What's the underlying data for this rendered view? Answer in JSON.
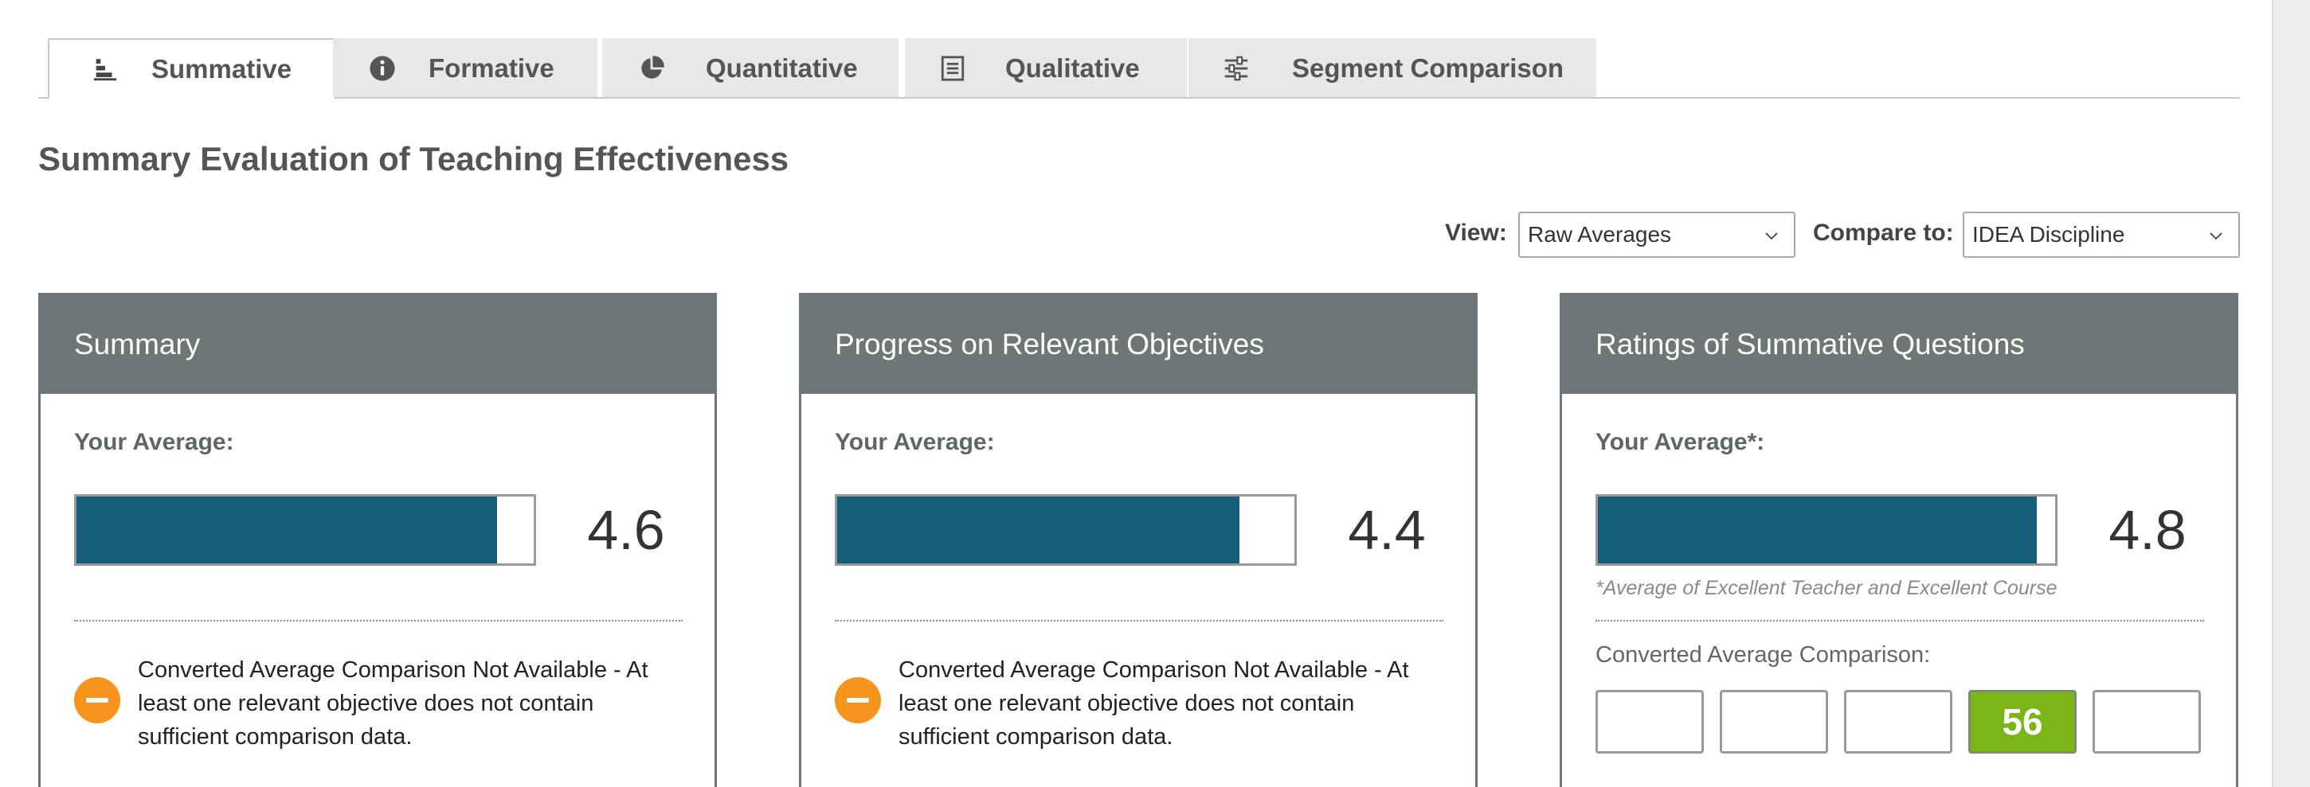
{
  "tabs": [
    {
      "label": "Summative",
      "icon": "bar-chart-icon",
      "active": true
    },
    {
      "label": "Formative",
      "icon": "info-icon",
      "active": false
    },
    {
      "label": "Quantitative",
      "icon": "pie-chart-icon",
      "active": false
    },
    {
      "label": "Qualitative",
      "icon": "document-icon",
      "active": false
    },
    {
      "label": "Segment Comparison",
      "icon": "sliders-icon",
      "active": false
    }
  ],
  "page_title": "Summary Evaluation of Teaching Effectiveness",
  "filters": {
    "view_label": "View:",
    "view_value": "Raw Averages",
    "compare_label": "Compare to:",
    "compare_value": "IDEA Discipline"
  },
  "cards": [
    {
      "title": "Summary",
      "avg_label": "Your Average:",
      "value": "4.6",
      "fill_fraction": 0.92,
      "note": "Converted Average Comparison Not Available - At least one relevant objective does not contain sufficient comparison data."
    },
    {
      "title": "Progress on Relevant Objectives",
      "avg_label": "Your Average:",
      "value": "4.4",
      "fill_fraction": 0.88,
      "note": "Converted Average Comparison Not Available - At least one relevant objective does not contain sufficient comparison data."
    },
    {
      "title": "Ratings of Summative Questions",
      "avg_label": "Your Average*:",
      "value": "4.8",
      "fill_fraction": 0.96,
      "footnote": "*Average of Excellent Teacher and Excellent Course",
      "comparison_label": "Converted Average Comparison:",
      "comparison_boxes": [
        "",
        "",
        "",
        "56",
        ""
      ],
      "comparison_highlight_index": 3
    }
  ],
  "colors": {
    "card_header": "#6f7678",
    "bar_fill": "#155e79",
    "warning": "#f7941d",
    "highlight": "#7cb518"
  }
}
